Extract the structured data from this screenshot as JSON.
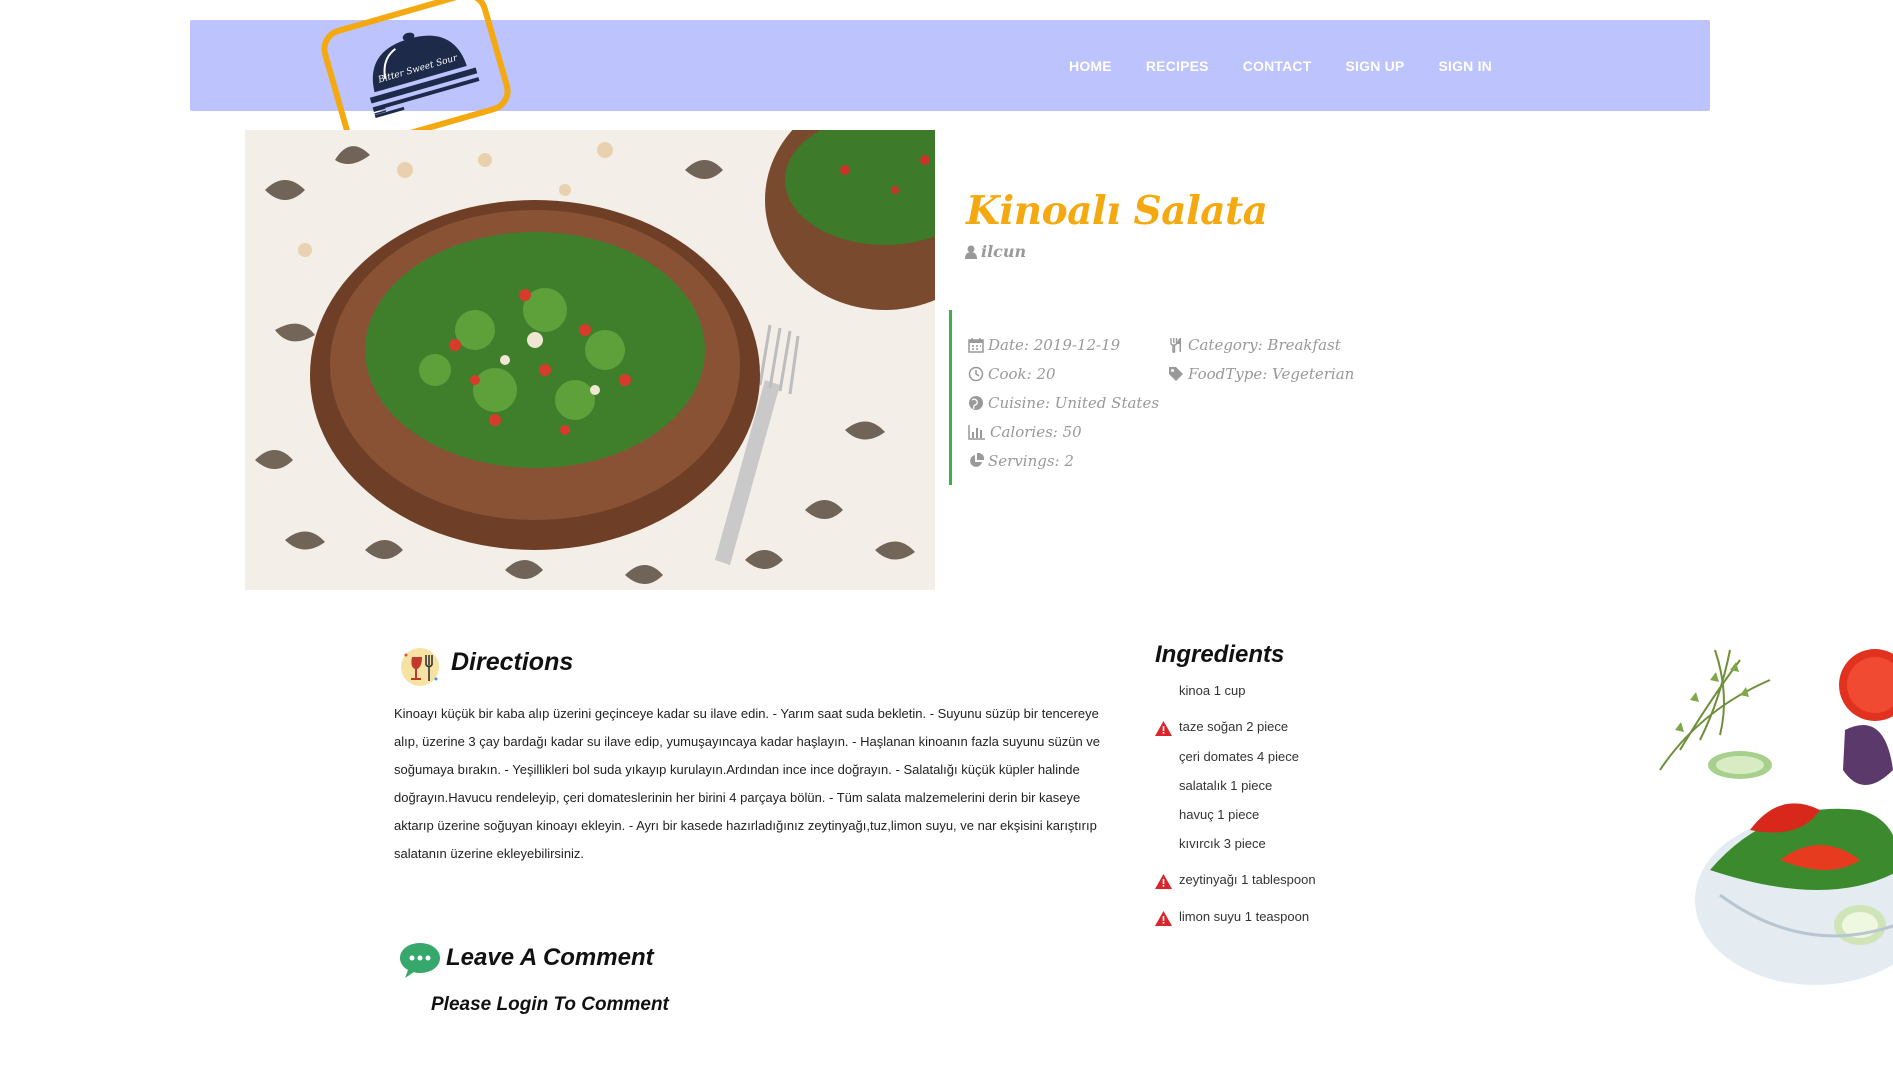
{
  "brand": {
    "logo_text": "Bitter Sweet Sour",
    "accent": "#f5a911",
    "navbar_bg": "#bcc3fd"
  },
  "nav": {
    "items": [
      {
        "label": "HOME"
      },
      {
        "label": "RECIPES"
      },
      {
        "label": "CONTACT"
      },
      {
        "label": "SIGN UP"
      },
      {
        "label": "SIGN IN"
      }
    ]
  },
  "recipe": {
    "title": "Kinoalı Salata",
    "author": "ilcun",
    "meta_left": [
      {
        "icon": "calendar-icon",
        "text": "Date: 2019-12-19"
      },
      {
        "icon": "clock-icon",
        "text": "Cook: 20"
      },
      {
        "icon": "globe-icon",
        "text": "Cuisine: United States"
      },
      {
        "icon": "bar-chart-icon",
        "text": "Calories: 50"
      },
      {
        "icon": "pie-chart-icon",
        "text": "Servings: 2"
      }
    ],
    "meta_right": [
      {
        "icon": "utensils-icon",
        "text": "Category: Breakfast"
      },
      {
        "icon": "tag-icon",
        "text": "FoodType: Vegeterian"
      }
    ]
  },
  "directions": {
    "title": "Directions",
    "text": "Kinoayı küçük bir kaba alıp üzerini geçinceye kadar su ilave edin. - Yarım saat suda bekletin. - Suyunu süzüp bir tencereye alıp, üzerine 3 çay bardağı kadar su ilave edip, yumuşayıncaya kadar haşlayın. - Haşlanan kinoanın fazla suyunu süzün ve soğumaya bırakın. - Yeşillikleri bol suda yıkayıp kurulayın.Ardından ince ince doğrayın. - Salatalığı küçük küpler halinde doğrayın.Havucu rendeleyip, çeri domateslerinin her birini 4 parçaya bölün. - Tüm salata malzemelerini derin bir kaseye aktarıp üzerine soğuyan kinoayı ekleyin. - Ayrı bir kasede hazırladığınız zeytinyağı,tuz,limon suyu, ve nar ekşisini karıştırıp salatanın üzerine ekleyebilirsiniz."
  },
  "ingredients": {
    "title": "Ingredients",
    "items": [
      {
        "text": "kinoa 1 cup",
        "warning": false
      },
      {
        "text": "taze soğan 2 piece",
        "warning": true
      },
      {
        "text": "çeri domates 4 piece",
        "warning": false
      },
      {
        "text": "salatalık 1 piece",
        "warning": false
      },
      {
        "text": "havuç 1 piece",
        "warning": false
      },
      {
        "text": "kıvırcık 3 piece",
        "warning": false
      },
      {
        "text": "zeytinyağı 1 tablespoon",
        "warning": true
      },
      {
        "text": "limon suyu 1 teaspoon",
        "warning": true
      }
    ]
  },
  "comment": {
    "title": "Leave A Comment",
    "login_prompt": "Please Login To Comment"
  }
}
